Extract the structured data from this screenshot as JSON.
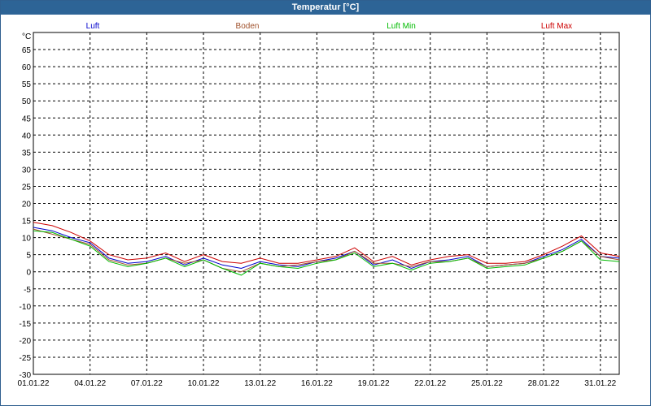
{
  "window": {
    "title": "Temperatur [°C]"
  },
  "chart_data": {
    "type": "line",
    "title": "Temperatur [°C]",
    "ylabel": "°C",
    "xlabel": "",
    "ylim": [
      -30,
      70
    ],
    "yticks": [
      65,
      60,
      55,
      50,
      45,
      40,
      35,
      30,
      25,
      20,
      15,
      10,
      5,
      0,
      -5,
      -10,
      -15,
      -20,
      -25,
      -30
    ],
    "xlim": [
      "2022-01-01",
      "2022-02-01"
    ],
    "xtick_labels": [
      "01.01.22",
      "04.01.22",
      "07.01.22",
      "10.01.22",
      "13.01.22",
      "16.01.22",
      "19.01.22",
      "22.01.22",
      "25.01.22",
      "28.01.22",
      "31.01.22"
    ],
    "grid": true,
    "legend_position": "top",
    "x": [
      "2022-01-01",
      "2022-01-02",
      "2022-01-03",
      "2022-01-04",
      "2022-01-05",
      "2022-01-06",
      "2022-01-07",
      "2022-01-08",
      "2022-01-09",
      "2022-01-10",
      "2022-01-11",
      "2022-01-12",
      "2022-01-13",
      "2022-01-14",
      "2022-01-15",
      "2022-01-16",
      "2022-01-17",
      "2022-01-18",
      "2022-01-19",
      "2022-01-20",
      "2022-01-21",
      "2022-01-22",
      "2022-01-23",
      "2022-01-24",
      "2022-01-25",
      "2022-01-26",
      "2022-01-27",
      "2022-01-28",
      "2022-01-29",
      "2022-01-30",
      "2022-01-31",
      "2022-02-01"
    ],
    "series": [
      {
        "name": "Luft",
        "color": "#0000cc",
        "values": [
          13,
          12,
          10,
          8.5,
          4,
          2.5,
          3,
          4.5,
          2,
          4,
          2,
          1,
          3,
          2,
          1.5,
          3,
          4,
          6,
          2,
          3.5,
          1,
          3,
          3.5,
          4.5,
          1.5,
          2,
          2.5,
          4.5,
          6.5,
          9.5,
          4.5,
          4
        ]
      },
      {
        "name": "Boden",
        "color": "#a0522d",
        "values": [
          12.5,
          11,
          9.5,
          8,
          3.5,
          2,
          2.5,
          4,
          2.5,
          3.5,
          1,
          0,
          2.5,
          1.5,
          2,
          3,
          3.5,
          6,
          2.5,
          2.5,
          1.5,
          3,
          3,
          4,
          1.5,
          2,
          2.5,
          4,
          6,
          9,
          4.5,
          3.5
        ]
      },
      {
        "name": "Luft Min",
        "color": "#00bb00",
        "values": [
          12,
          11.5,
          9.5,
          7.5,
          3,
          1.5,
          2.5,
          4,
          1.5,
          3.5,
          1,
          -1,
          2.5,
          1.5,
          1,
          2.5,
          3.5,
          5.5,
          1.5,
          2.5,
          0.5,
          2.5,
          3,
          4,
          1,
          1.5,
          2,
          4,
          6,
          9,
          3.5,
          3
        ]
      },
      {
        "name": "Luft Max",
        "color": "#cc0000",
        "values": [
          14.5,
          13.5,
          11.5,
          9,
          5,
          3.5,
          4,
          5.5,
          3,
          5,
          3,
          2.5,
          4,
          2.5,
          2.5,
          3.5,
          4.5,
          7,
          3,
          4.5,
          2,
          3.5,
          4.5,
          5,
          2.5,
          2.5,
          3,
          5,
          7.5,
          10.5,
          5.5,
          4.5
        ]
      }
    ]
  }
}
